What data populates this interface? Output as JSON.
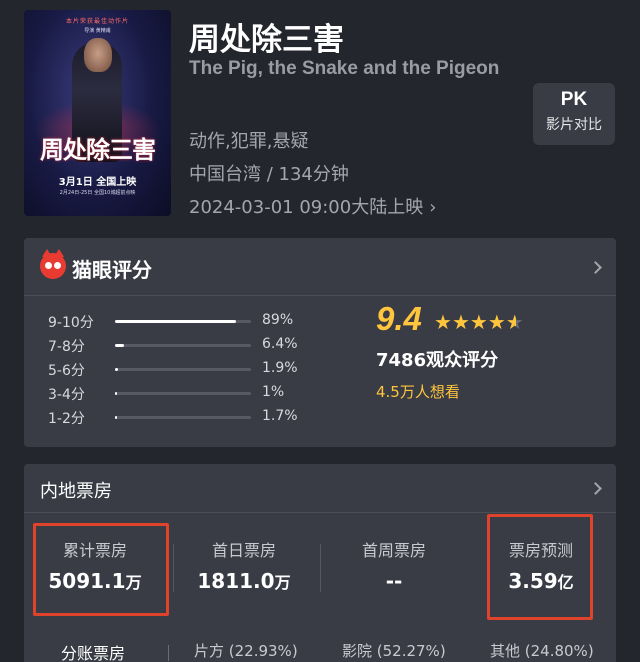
{
  "movie": {
    "title": "周处除三害",
    "title_en": "The Pig, the Snake and the Pigeon",
    "genres": "动作,犯罪,悬疑",
    "country_duration": "中国台湾 / 134分钟",
    "release": "2024-03-01 09:00大陆上映",
    "poster": {
      "top_text": "本片荣获最佳动作片",
      "sub_text": "导演 黄精甫",
      "title": "周处除三害",
      "date_text": "3月1日 全国上映",
      "note_text": "2月24日-25日 全国10城超前点映"
    }
  },
  "pk_button": {
    "main": "PK",
    "sub": "影片对比"
  },
  "rating": {
    "header": "猫眼评分",
    "distribution": [
      {
        "label": "9-10分",
        "pct": "89%",
        "value": 0.89
      },
      {
        "label": "7-8分",
        "pct": "6.4%",
        "value": 0.064
      },
      {
        "label": "5-6分",
        "pct": "1.9%",
        "value": 0.019
      },
      {
        "label": "3-4分",
        "pct": "1%",
        "value": 0.01
      },
      {
        "label": "1-2分",
        "pct": "1.7%",
        "value": 0.017
      }
    ],
    "score": "9.4",
    "stars_value": 4.5,
    "votes": "7486观众评分",
    "wish": "4.5万人想看"
  },
  "box_office": {
    "header": "内地票房",
    "stats": [
      {
        "label": "累计票房",
        "value": "5091.1",
        "unit": "万",
        "highlighted": true
      },
      {
        "label": "首日票房",
        "value": "1811.0",
        "unit": "万",
        "highlighted": false
      },
      {
        "label": "首周票房",
        "value": "--",
        "unit": "",
        "highlighted": false
      },
      {
        "label": "票房预测",
        "value": "3.59",
        "unit": "亿",
        "highlighted": true
      }
    ],
    "share": {
      "title": "分账票房",
      "items": [
        "片方 (22.93%)",
        "影院 (52.27%)",
        "其他 (24.80%)"
      ]
    }
  },
  "colors": {
    "background": "#24262e",
    "card": "#3a3c45",
    "accent_gold": "#ffc53d",
    "highlight_red": "#e0432c",
    "brand_red": "#ea3b32"
  }
}
